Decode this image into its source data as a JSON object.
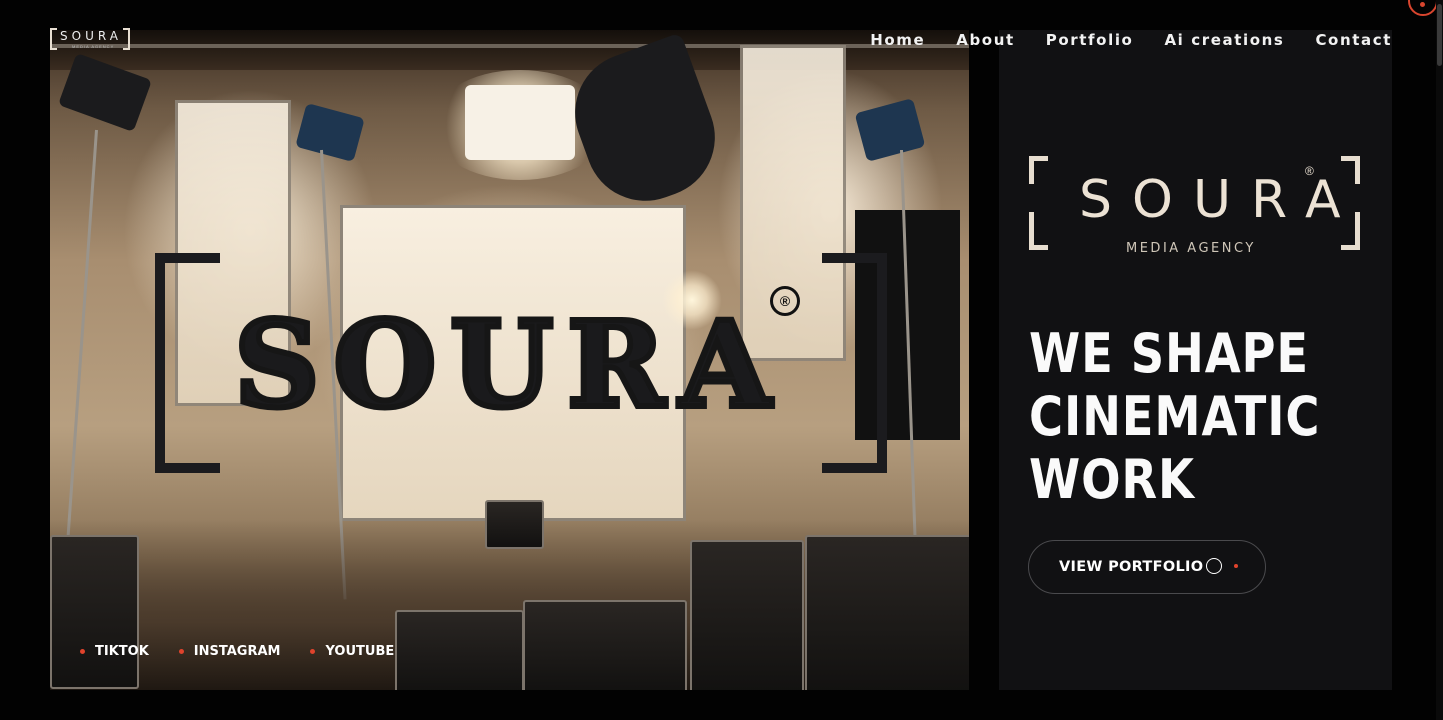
{
  "logo_small": {
    "text": "SOURA",
    "sub": "MEDIA AGENCY"
  },
  "nav": [
    "Home",
    "About",
    "Portfolio",
    "Ai creations",
    "Contact"
  ],
  "hero": {
    "artwork_text": "SOURA",
    "artwork_reg": "®",
    "socials": [
      "TIKTOK",
      "INSTAGRAM",
      "YOUTUBE"
    ]
  },
  "brand": {
    "word": "SOURA",
    "reg": "®",
    "sub": "MEDIA AGENCY"
  },
  "headline": [
    "WE SHAPE",
    "CINEMATIC",
    "WORK"
  ],
  "cta": {
    "label": "VIEW PORTFOLIO"
  },
  "colors": {
    "accent": "#e0432c",
    "panel": "#111113",
    "background": "#020202",
    "brand_cream": "#ece2d4"
  },
  "icons": [
    "circle-icon",
    "dot-icon",
    "menu-circle-icon"
  ]
}
